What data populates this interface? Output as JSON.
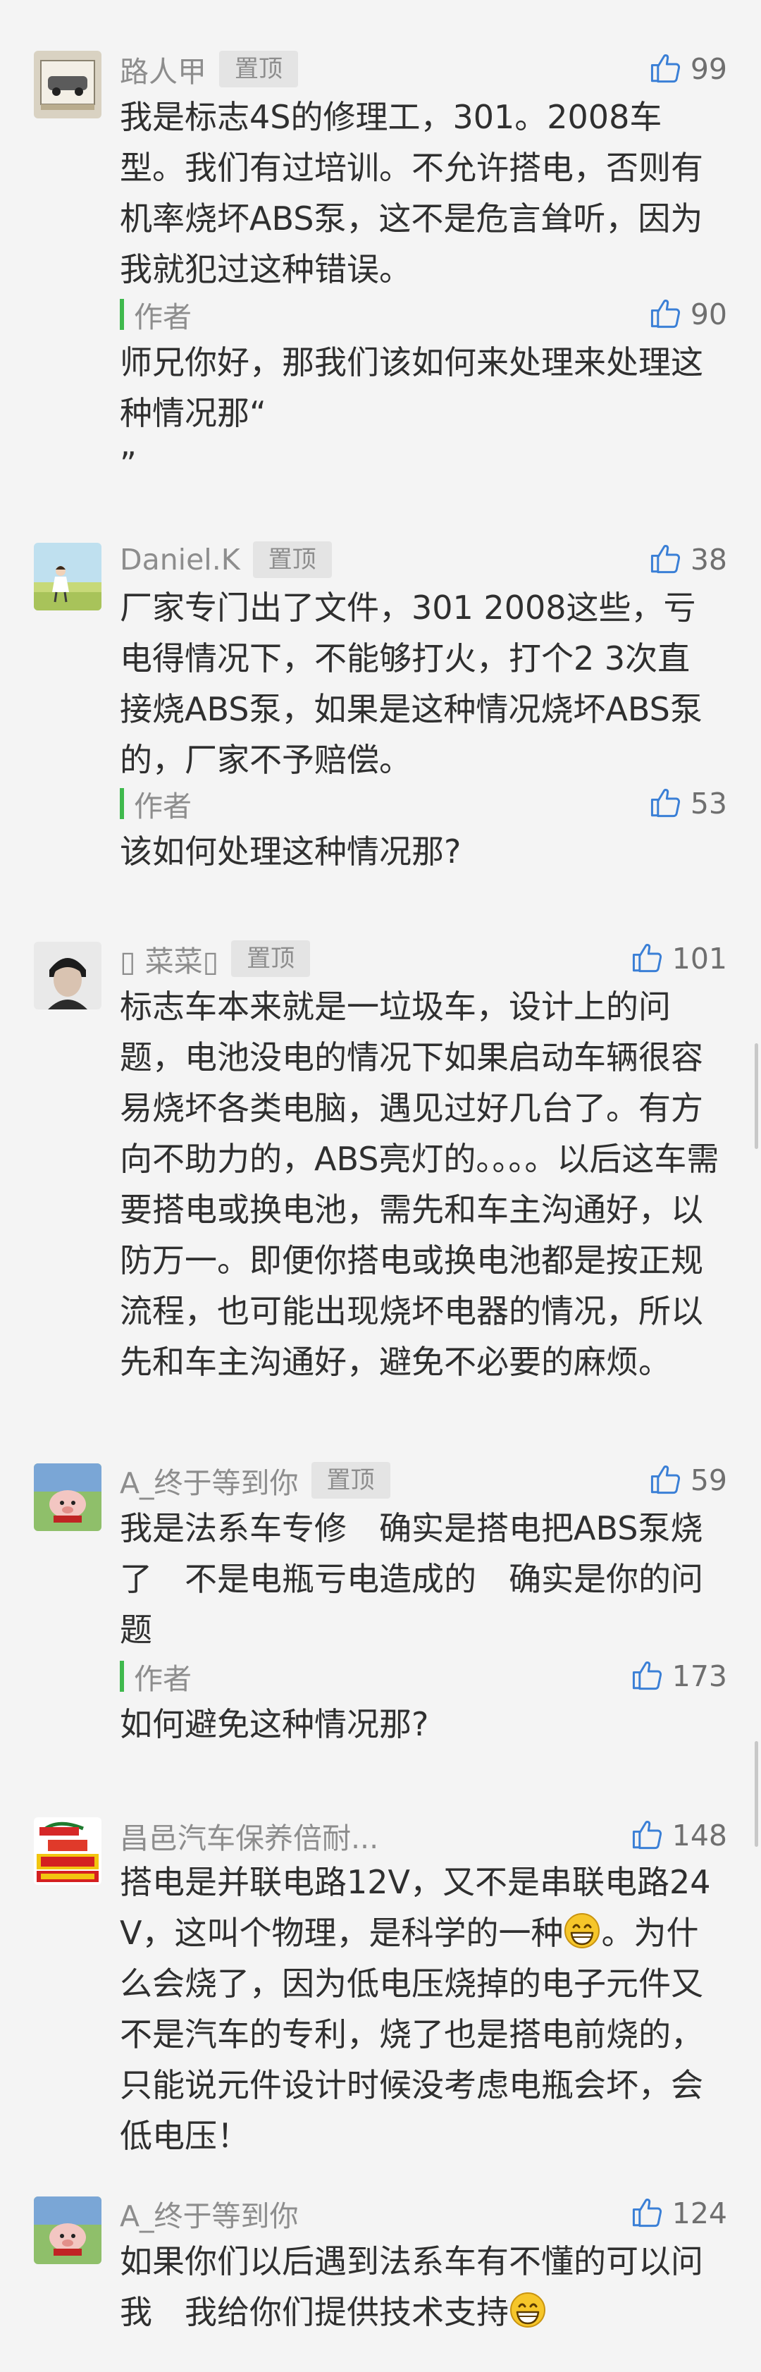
{
  "comments": [
    {
      "username": "路人甲",
      "badge": "置顶",
      "likes": "99",
      "text": "我是标志4S的修理工，301。2008车型。我们有过培训。不允许搭电，否则有机率烧坏ABS泵，这不是危言耸听，因为我就犯过这种错误。",
      "reply": {
        "author": "作者",
        "likes": "90",
        "text": "师兄你好，那我们该如何来处理来处理这种情况那“\n”"
      }
    },
    {
      "username": "Daniel.K",
      "badge": "置顶",
      "likes": "38",
      "text": "厂家专门出了文件，301 2008这些，亏电得情况下，不能够打火，打个2 3次直接烧ABS泵，如果是这种情况烧坏ABS泵的，厂家不予赔偿。",
      "reply": {
        "author": "作者",
        "likes": "53",
        "text": "该如何处理这种情况那?"
      }
    },
    {
      "username": "\u0000 菜菜\u0000",
      "username_display": "▯ 菜菜▯",
      "badge": "置顶",
      "likes": "101",
      "text": "标志车本来就是一垃圾车，设计上的问题，电池没电的情况下如果启动车辆很容易烧坏各类电脑，遇见过好几台了。有方向不助力的，ABS亮灯的。。。。以后这车需要搭电或换电池，需先和车主沟通好，以防万一。即便你搭电或换电池都是按正规流程，也可能出现烧坏电器的情况，所以先和车主沟通好，避免不必要的麻烦。"
    },
    {
      "username": "A_终于等到你",
      "badge": "置顶",
      "likes": "59",
      "text": "我是法系车专修　确实是搭电把ABS泵烧了　不是电瓶亏电造成的　确实是你的问题",
      "reply": {
        "author": "作者",
        "likes": "173",
        "text": "如何避免这种情况那?"
      }
    },
    {
      "username": "昌邑汽车保养倍耐...",
      "likes": "148",
      "text_a": "搭电是并联电路12V，又不是串联电路24V，这叫个物理，是科学的一种",
      "text_b": "。为什么会烧了，因为低电压烧掉的电子元件又不是汽车的专利，烧了也是搭电前烧的，只能说元件设计时候没考虑电瓶会坏，会低电压！"
    },
    {
      "username": "A_终于等到你",
      "likes": "124",
      "text_a": "如果你们以后遇到法系车有不懂的可以问我　我给你们提供技术支持",
      "text_b": ""
    }
  ],
  "icons": {
    "like": "thumbs-up-icon",
    "emoji": "grinning-face-icon"
  },
  "colors": {
    "background": "#f4f4f4",
    "reply_bar": "#3fb94d",
    "meta_text": "#8d8d8d",
    "body_text": "#2f2f2f"
  }
}
